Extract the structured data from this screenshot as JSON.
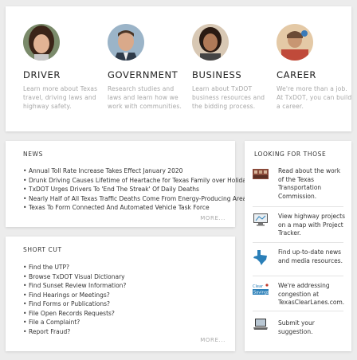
{
  "personas": [
    {
      "title": "DRIVER",
      "desc": "Learn more about Texas travel, driving laws and highway safety."
    },
    {
      "title": "GOVERNMENT",
      "desc": "Research studies and laws and learn how we work with communities."
    },
    {
      "title": "BUSINESS",
      "desc": "Learn about TxDOT business resources and the bidding process."
    },
    {
      "title": "CAREER",
      "desc": "We're more than a job. At TxDOT, you can build a career."
    }
  ],
  "news": {
    "heading": "NEWS",
    "items": [
      "Annual Toll Rate Increase Takes Effect January 2020",
      "Drunk Driving Causes Lifetime of Heartache for Texas Family over Holidays",
      "TxDOT Urges Drivers To 'End The Streak' Of Daily Deaths",
      "Nearly Half of All Texas Traffic Deaths Come From Energy-Producing Areas",
      "Texas To Form Connected And Automated Vehicle Task Force"
    ],
    "more": "MORE..."
  },
  "shortcut": {
    "heading": "SHORT CUT",
    "items": [
      "Find the UTP?",
      "Browse TxDOT Visual Dictionary",
      "Find Sunset Review Information?",
      "Find Hearings or Meetings?",
      "Find Forms or Publications?",
      "File Open Records Requests?",
      "File a Complaint?",
      "Report Fraud?"
    ],
    "more": "MORE..."
  },
  "looking": {
    "heading": "LOOKING FOR THOSE",
    "items": [
      {
        "icon": "commission-icon",
        "text": "Read about the work of the Texas Transportation Commission."
      },
      {
        "icon": "project-tracker-icon",
        "text": "View highway projects on a map with Project Tracker."
      },
      {
        "icon": "texas-map-icon",
        "text": "Find up-to-date news and media resources."
      },
      {
        "icon": "clear-lanes-icon",
        "text": "We're addressing congestion at TexasClearLanes.com."
      },
      {
        "icon": "laptop-suggestion-icon",
        "text": "Submit your suggestion."
      }
    ]
  },
  "colors": {
    "accent_blue": "#2a7fb8",
    "muted_text": "#a7a7a7",
    "background": "#ececec"
  }
}
